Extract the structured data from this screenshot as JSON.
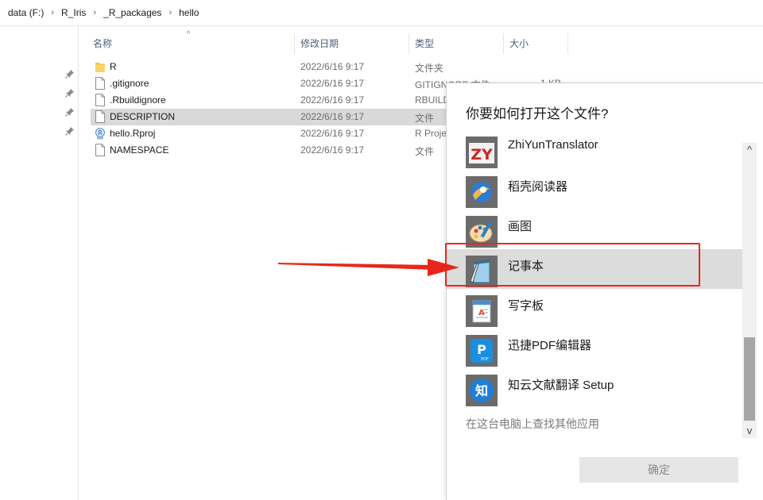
{
  "breadcrumb": [
    "data (F:)",
    "R_Iris",
    "_R_packages",
    "hello"
  ],
  "columns": {
    "name": "名称",
    "date": "修改日期",
    "type": "类型",
    "size": "大小"
  },
  "files": [
    {
      "name": "R",
      "date": "2022/6/16 9:17",
      "type": "文件夹",
      "size": "",
      "icon": "folder-icon"
    },
    {
      "name": ".gitignore",
      "date": "2022/6/16 9:17",
      "type": "GITIGNORE 文件",
      "size": "1 KB",
      "icon": "file-icon"
    },
    {
      "name": ".Rbuildignore",
      "date": "2022/6/16 9:17",
      "type": "RBUILD",
      "size": "",
      "icon": "file-icon"
    },
    {
      "name": "DESCRIPTION",
      "date": "2022/6/16 9:17",
      "type": "文件",
      "size": "",
      "icon": "file-icon",
      "selected": true
    },
    {
      "name": "hello.Rproj",
      "date": "2022/6/16 9:17",
      "type": "R Proje",
      "size": "",
      "icon": "rproj-icon"
    },
    {
      "name": "NAMESPACE",
      "date": "2022/6/16 9:17",
      "type": "文件",
      "size": "",
      "icon": "file-icon"
    }
  ],
  "dialog": {
    "title": "你要如何打开这个文件?",
    "apps": [
      {
        "name": "ZhiYunTranslator",
        "icon": "zhiyun-translator-icon"
      },
      {
        "name": "稻壳阅读器",
        "icon": "docer-reader-icon"
      },
      {
        "name": "画图",
        "icon": "paint-icon"
      },
      {
        "name": "记事本",
        "icon": "notepad-icon",
        "highlighted": true
      },
      {
        "name": "写字板",
        "icon": "wordpad-icon"
      },
      {
        "name": "迅捷PDF编辑器",
        "icon": "pdf-editor-icon"
      },
      {
        "name": "知云文献翻译 Setup",
        "icon": "zhiyun-setup-icon"
      }
    ],
    "more_link": "在这台电脑上查找其他应用",
    "ok_label": "确定"
  },
  "colors": {
    "annotation_red": "#e8271a",
    "selected_row": "#d9d9d9",
    "highlight_app": "#dcdcdc",
    "folder_yellow": "#f5c242"
  }
}
